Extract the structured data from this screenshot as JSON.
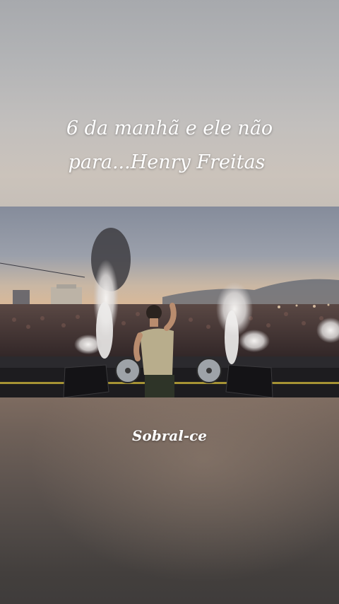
{
  "caption": {
    "line1": "6 da manhã e ele não",
    "line2": "para...Henry Freitas"
  },
  "location_caption": "Sobral-ce",
  "colors": {
    "caption_text": "#ffffff",
    "top_backdrop": "#b5b6b8",
    "bottom_backdrop": "#5f5550",
    "sky": "#8f95a3",
    "stage": "#1d1c1f"
  }
}
